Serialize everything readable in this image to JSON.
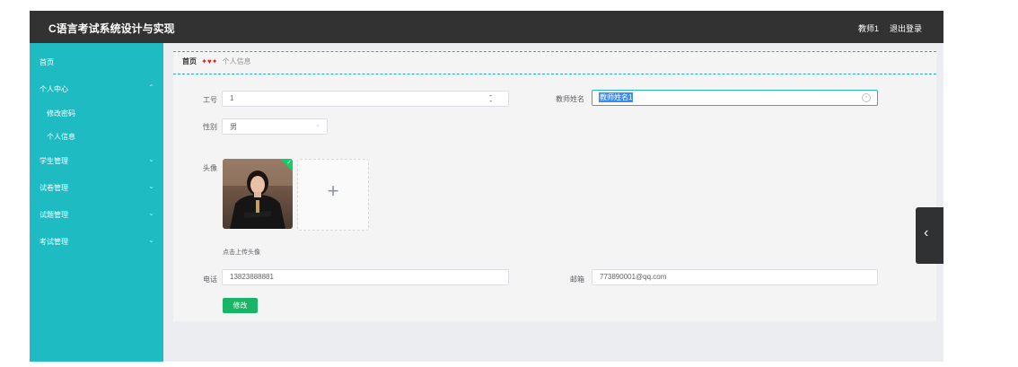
{
  "header": {
    "title": "C语言考试系统设计与实现",
    "user": "教师1",
    "logout": "退出登录"
  },
  "sidebar": {
    "items": [
      {
        "label": "首页",
        "arrow": ""
      },
      {
        "label": "个人中心",
        "arrow": "⌃"
      },
      {
        "label": "修改密码",
        "arrow": ""
      },
      {
        "label": "个人信息",
        "arrow": ""
      },
      {
        "label": "学生管理",
        "arrow": "⌄"
      },
      {
        "label": "试卷管理",
        "arrow": "⌄"
      },
      {
        "label": "试题管理",
        "arrow": "⌄"
      },
      {
        "label": "考试管理",
        "arrow": "⌄"
      }
    ]
  },
  "breadcrumb": {
    "home": "首页",
    "separator": "✦♥✦",
    "current": "个人信息"
  },
  "form": {
    "gonghao": {
      "label": "工号",
      "value": "1"
    },
    "jiaoshixingming": {
      "label": "教师姓名",
      "value": "教师姓名1"
    },
    "xingbie": {
      "label": "性别",
      "value": "男"
    },
    "touxiang": {
      "label": "头像",
      "tip": "点击上传头像"
    },
    "dianhua": {
      "label": "电话",
      "value": "13823888881"
    },
    "youxiang": {
      "label": "邮箱",
      "value": "773890001@qq.com"
    },
    "submit": "修改"
  },
  "colors": {
    "sidebar": "#1fbbc2",
    "topbar": "#323232",
    "accent": "#18b566"
  }
}
